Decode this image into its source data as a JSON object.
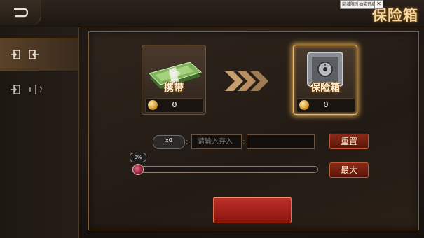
{
  "title": "保险箱",
  "tooltip": {
    "text": "商城限时抽奖开启~",
    "close": "✕"
  },
  "sidebar": {
    "items": [
      {
        "name": "deposit",
        "active": true
      },
      {
        "name": "withdraw",
        "active": false
      }
    ]
  },
  "carry": {
    "label": "携带",
    "value": "0"
  },
  "safe": {
    "label": "保险箱",
    "value": "0"
  },
  "amount": {
    "badge": "x0",
    "placeholder": "请输入存入"
  },
  "buttons": {
    "reset": "重置",
    "max": "最大",
    "confirm": ""
  },
  "slider": {
    "percent_label": "0%",
    "value": 0
  },
  "colors": {
    "accent": "#f3d8a0",
    "button": "#8a2a18",
    "glow": "#e6b86a"
  }
}
